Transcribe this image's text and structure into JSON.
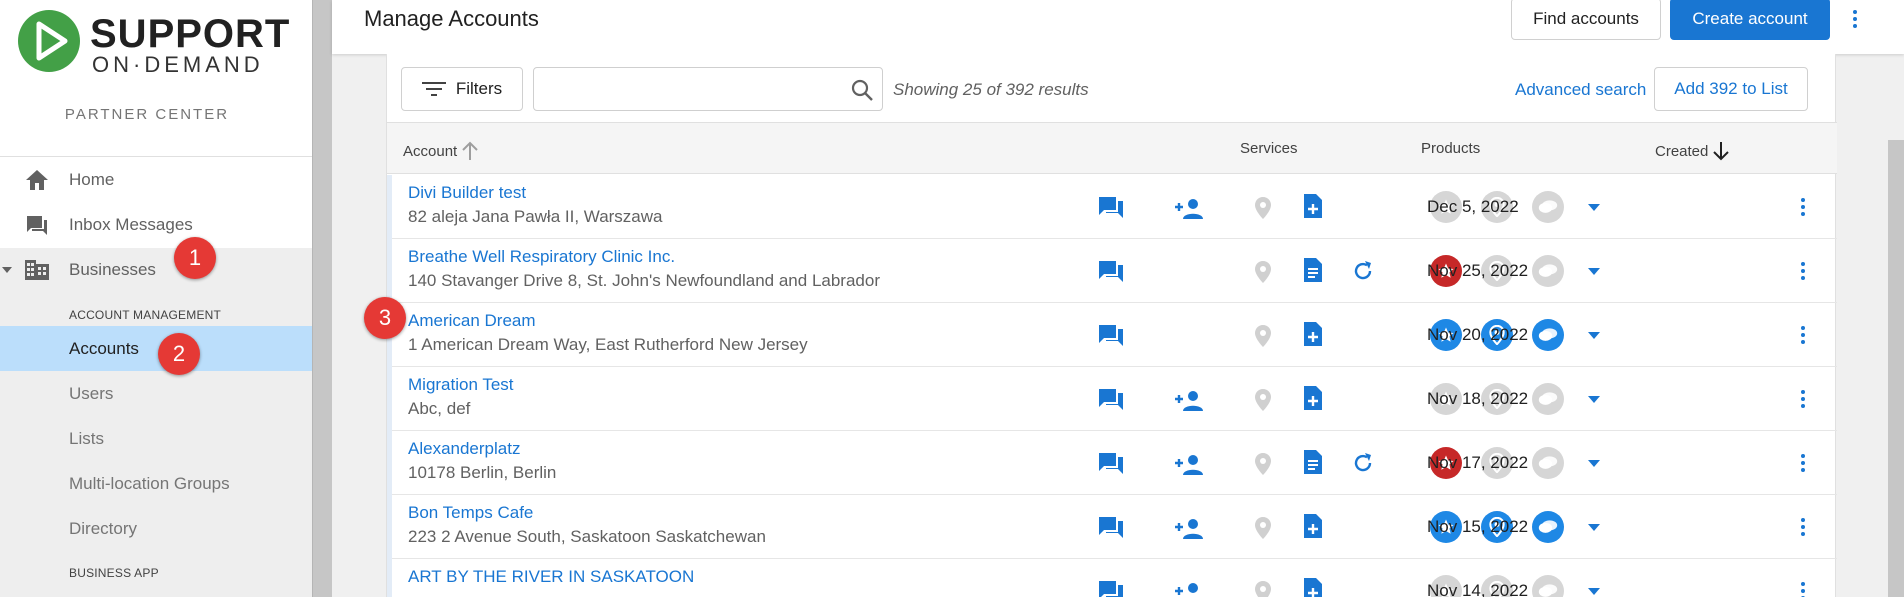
{
  "brand": {
    "name_line1": "SUPPORT",
    "name_line2": "ON·DEMAND",
    "subtitle": "PARTNER CENTER",
    "color_green": "#43a047"
  },
  "sidebar": {
    "nav": [
      {
        "label": "Home",
        "icon": "home-icon"
      },
      {
        "label": "Inbox Messages",
        "icon": "inbox-messages-icon"
      },
      {
        "label": "Businesses",
        "icon": "businesses-icon"
      }
    ],
    "section_account": "ACCOUNT MANAGEMENT",
    "sub_items": [
      "Accounts",
      "Users",
      "Lists",
      "Multi-location Groups",
      "Directory"
    ],
    "section_business_app": "BUSINESS APP",
    "active": "Accounts"
  },
  "annotations": [
    "1",
    "2",
    "3"
  ],
  "header": {
    "title": "Manage Accounts",
    "find_accounts": "Find accounts",
    "create_account": "Create account"
  },
  "toolbar": {
    "filters": "Filters",
    "search_value": "",
    "showing": "Showing 25 of 392 results",
    "advanced_search": "Advanced search",
    "add_to_list": "Add 392 to List"
  },
  "table": {
    "headers": {
      "account": "Account",
      "services": "Services",
      "products": "Products",
      "created": "Created"
    },
    "sort": {
      "account": "ascending",
      "created": "descending"
    },
    "rows": [
      {
        "name": "Divi Builder test",
        "address": "82 aleja Jana Pawła II, Warszawa",
        "created": "Dec 5, 2022",
        "add_user": true,
        "listing_doc": "add",
        "refresh": false,
        "products": [
          "gray",
          "gray",
          "gray"
        ]
      },
      {
        "name": "Breathe Well Respiratory Clinic Inc.",
        "address": "140 Stavanger Drive 8, St. John's Newfoundland and Labrador",
        "created": "Nov 25, 2022",
        "add_user": false,
        "listing_doc": "doc",
        "refresh": true,
        "products": [
          "red",
          "gray",
          "gray"
        ]
      },
      {
        "name": "American Dream",
        "address": "1 American Dream Way, East Rutherford New Jersey",
        "created": "Nov 20, 2022",
        "add_user": false,
        "listing_doc": "add",
        "refresh": false,
        "products": [
          "blue",
          "blue",
          "blue"
        ]
      },
      {
        "name": "Migration Test",
        "address": "Abc, def",
        "created": "Nov 18, 2022",
        "add_user": true,
        "listing_doc": "add",
        "refresh": false,
        "products": [
          "gray",
          "gray",
          "gray"
        ]
      },
      {
        "name": "Alexanderplatz",
        "address": "10178 Berlin, Berlin",
        "created": "Nov 17, 2022",
        "add_user": true,
        "listing_doc": "doc",
        "refresh": true,
        "products": [
          "red",
          "gray",
          "gray"
        ]
      },
      {
        "name": "Bon Temps Cafe",
        "address": "223 2 Avenue South, Saskatoon Saskatchewan",
        "created": "Nov 15, 2022",
        "add_user": true,
        "listing_doc": "add",
        "refresh": false,
        "products": [
          "blue",
          "blue",
          "blue"
        ]
      },
      {
        "name": "ART BY THE RIVER IN SASKATOON",
        "address": "",
        "created": "Nov 14, 2022",
        "add_user": true,
        "listing_doc": "add",
        "refresh": false,
        "products": [
          "gray",
          "gray",
          "gray"
        ]
      }
    ]
  },
  "colors": {
    "accent": "#1976d2",
    "annotation_red": "#e53935",
    "active_bg": "#bbdefb"
  }
}
